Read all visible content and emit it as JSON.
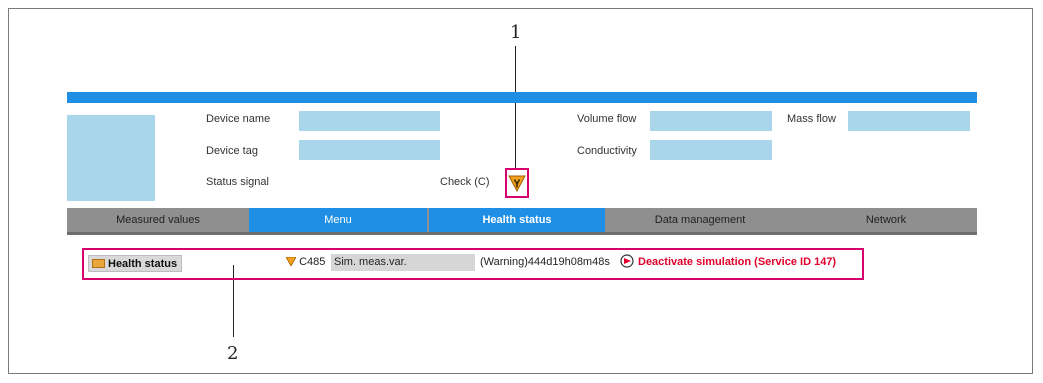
{
  "callouts": {
    "one": "1",
    "two": "2"
  },
  "header": {
    "device_name_label": "Device name",
    "device_tag_label": "Device tag",
    "status_signal_label": "Status signal",
    "check_label": "Check (C)",
    "volume_flow_label": "Volume flow",
    "conductivity_label": "Conductivity",
    "mass_flow_label": "Mass flow"
  },
  "nav": {
    "items": [
      {
        "label": "Measured values",
        "active": false
      },
      {
        "label": "Menu",
        "active": true
      },
      {
        "label": "Health status",
        "active": true
      },
      {
        "label": "Data management",
        "active": false
      },
      {
        "label": "Network",
        "active": false
      }
    ]
  },
  "health": {
    "button_label": "Health status",
    "code": "C485",
    "message": "Sim. meas.var.",
    "warning_text": "(Warning)444d19h08m48s",
    "action_text": "Deactivate simulation (Service ID 147)"
  },
  "colors": {
    "accent_blue": "#1e8fe5",
    "field_blue": "#a9d6ea",
    "highlight_magenta": "#d6006e",
    "action_red": "#e0002a"
  },
  "icons": {
    "check_icon": "check-function-wrench-icon",
    "status_icon": "warning-triangle-icon",
    "deactivate_icon": "arrow-circle-icon",
    "folder_icon": "folder-icon"
  }
}
